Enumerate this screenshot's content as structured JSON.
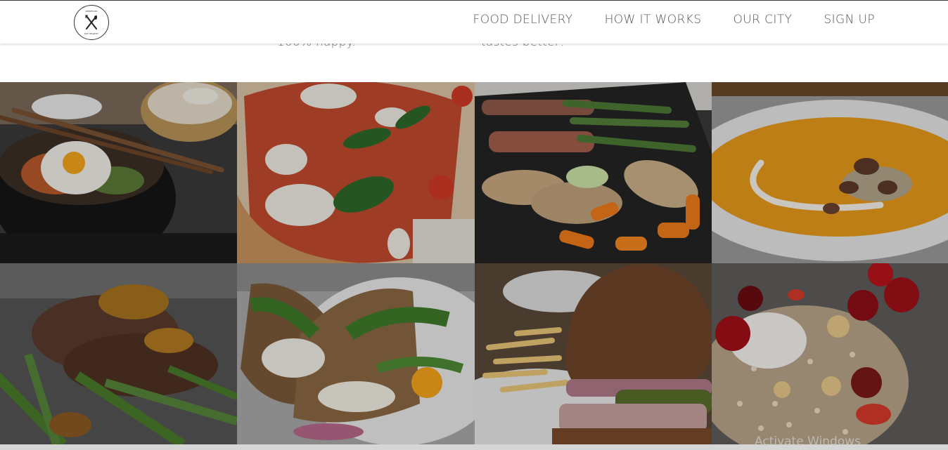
{
  "features": {
    "line1": "100% happy.",
    "line2": "tastes better!"
  },
  "nav": {
    "logo_top_text": "OMNIFOOD",
    "logo_bottom_text": "EAT HEALTHY",
    "links": [
      "FOOD DELIVERY",
      "HOW IT WORKS",
      "OUR CITY",
      "SIGN UP"
    ]
  },
  "meals": [
    "bibimbap",
    "pizza",
    "chicken-asparagus",
    "pumpkin-soup",
    "steak-asparagus",
    "sandwich",
    "burger-fries",
    "granola-cherries"
  ],
  "watermark": "Activate Windows",
  "colors": {
    "nav_bg": "#ffffff",
    "nav_text": "#555555",
    "overlay": "rgba(0,0,0,0.18)"
  }
}
